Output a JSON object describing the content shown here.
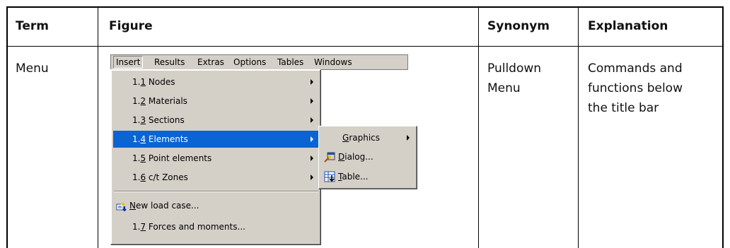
{
  "table": {
    "headers": {
      "term": "Term",
      "figure": "Figure",
      "synonym": "Synonym",
      "explanation": "Explanation"
    },
    "row": {
      "term": "Menu",
      "synonym_line1": "Pulldown",
      "synonym_line2": "Menu",
      "explanation_line1": "Commands and",
      "explanation_line2": "functions below",
      "explanation_line3": "the title bar"
    }
  },
  "figure": {
    "menubar": [
      "Insert",
      "Results",
      "Extras",
      "Options",
      "Tables",
      "Windows"
    ],
    "dropdown": [
      {
        "prefix": "1.",
        "key": "1",
        "text": " Nodes",
        "has_submenu": true
      },
      {
        "prefix": "1.",
        "key": "2",
        "text": " Materials",
        "has_submenu": true
      },
      {
        "prefix": "1.",
        "key": "3",
        "text": " Sections",
        "has_submenu": true
      },
      {
        "prefix": "1.",
        "key": "4",
        "text": " Elements",
        "has_submenu": true,
        "selected": true
      },
      {
        "prefix": "1.",
        "key": "5",
        "text": " Point elements",
        "has_submenu": true
      },
      {
        "prefix": "1.",
        "key": "6",
        "text": " c/t Zones",
        "has_submenu": true
      }
    ],
    "dropdown_lower": [
      {
        "key": "N",
        "text": "ew load case...",
        "icon": "new-load-case-icon"
      },
      {
        "prefix": "1.",
        "key": "7",
        "text": " Forces and moments..."
      }
    ],
    "submenu": [
      {
        "key": "G",
        "text": "raphics",
        "has_submenu": true
      },
      {
        "key": "D",
        "text": "ialog...",
        "icon": "dialog-icon"
      },
      {
        "key": "T",
        "text": "able...",
        "icon": "table-icon"
      }
    ],
    "colors": {
      "menu_face": "#d4d0c8",
      "highlight": "#0a64d2"
    }
  }
}
